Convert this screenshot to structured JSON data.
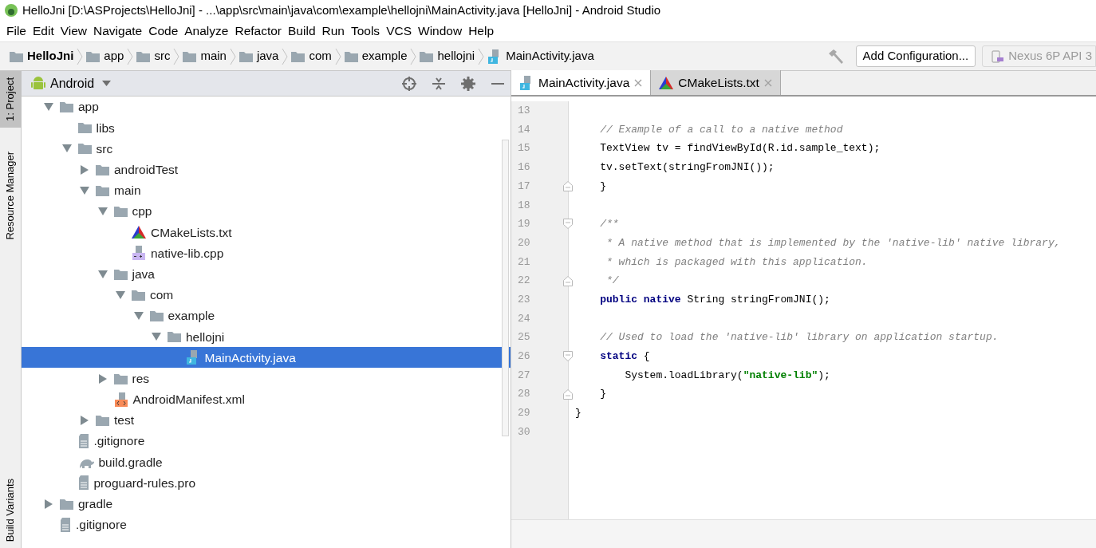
{
  "window": {
    "title": "HelloJni [D:\\ASProjects\\HelloJni] - ...\\app\\src\\main\\java\\com\\example\\hellojni\\MainActivity.java [HelloJni] - Android Studio"
  },
  "menu": [
    "File",
    "Edit",
    "View",
    "Navigate",
    "Code",
    "Analyze",
    "Refactor",
    "Build",
    "Run",
    "Tools",
    "VCS",
    "Window",
    "Help"
  ],
  "breadcrumb": [
    {
      "label": "HelloJni",
      "kind": "project"
    },
    {
      "label": "app",
      "kind": "folder"
    },
    {
      "label": "src",
      "kind": "folder"
    },
    {
      "label": "main",
      "kind": "folder"
    },
    {
      "label": "java",
      "kind": "folder"
    },
    {
      "label": "com",
      "kind": "folder"
    },
    {
      "label": "example",
      "kind": "folder"
    },
    {
      "label": "hellojni",
      "kind": "folder"
    },
    {
      "label": "MainActivity.java",
      "kind": "java"
    }
  ],
  "toolbar": {
    "config_button": "Add Configuration...",
    "device": "Nexus 6P API 3"
  },
  "side_tabs": [
    {
      "label": "1: Project",
      "selected": true
    },
    {
      "label": "Resource Manager",
      "selected": false
    },
    {
      "label": "Build Variants",
      "selected": false
    }
  ],
  "project_panel": {
    "view": "Android",
    "tree": [
      {
        "label": "app",
        "kind": "folder",
        "expanded": true,
        "selected": false,
        "children": [
          {
            "label": "libs",
            "kind": "folder",
            "selected": false
          },
          {
            "label": "src",
            "kind": "folder",
            "expanded": true,
            "selected": false,
            "children": [
              {
                "label": "androidTest",
                "kind": "folder",
                "expanded": false,
                "selected": false
              },
              {
                "label": "main",
                "kind": "folder",
                "expanded": true,
                "selected": false,
                "children": [
                  {
                    "label": "cpp",
                    "kind": "folder",
                    "expanded": true,
                    "selected": false,
                    "children": [
                      {
                        "label": "CMakeLists.txt",
                        "kind": "cmake",
                        "selected": false
                      },
                      {
                        "label": "native-lib.cpp",
                        "kind": "cpp",
                        "selected": false
                      }
                    ]
                  },
                  {
                    "label": "java",
                    "kind": "folder",
                    "expanded": true,
                    "selected": false,
                    "children": [
                      {
                        "label": "com",
                        "kind": "folder",
                        "expanded": true,
                        "selected": false,
                        "children": [
                          {
                            "label": "example",
                            "kind": "folder",
                            "expanded": true,
                            "selected": false,
                            "children": [
                              {
                                "label": "hellojni",
                                "kind": "folder",
                                "expanded": true,
                                "selected": false,
                                "children": [
                                  {
                                    "label": "MainActivity.java",
                                    "kind": "java",
                                    "selected": true
                                  }
                                ]
                              }
                            ]
                          }
                        ]
                      }
                    ]
                  },
                  {
                    "label": "res",
                    "kind": "folder",
                    "expanded": false,
                    "selected": false
                  },
                  {
                    "label": "AndroidManifest.xml",
                    "kind": "xml",
                    "selected": false
                  }
                ]
              },
              {
                "label": "test",
                "kind": "folder",
                "expanded": false,
                "selected": false
              }
            ]
          },
          {
            "label": ".gitignore",
            "kind": "text",
            "selected": false
          },
          {
            "label": "build.gradle",
            "kind": "gradle",
            "selected": false
          },
          {
            "label": "proguard-rules.pro",
            "kind": "text",
            "selected": false
          }
        ]
      },
      {
        "label": "gradle",
        "kind": "folder",
        "expanded": false,
        "selected": false
      },
      {
        "label": ".gitignore",
        "kind": "text",
        "selected": false
      }
    ]
  },
  "editor_tabs": [
    {
      "label": "MainActivity.java",
      "kind": "java",
      "selected": true
    },
    {
      "label": "CMakeLists.txt",
      "kind": "cmake",
      "selected": false
    }
  ],
  "code": [
    {
      "number": "13"
    },
    {
      "number": "14",
      "tokens": [
        {
          "kind": "comment",
          "text": "    // Example of a call to a native method"
        }
      ]
    },
    {
      "number": "15",
      "tokens": [
        {
          "kind": "plain",
          "text": "    TextView tv = findViewById(R.id.sample_text);"
        }
      ]
    },
    {
      "number": "16",
      "tokens": [
        {
          "kind": "plain",
          "text": "    tv.setText(stringFromJNI());"
        }
      ]
    },
    {
      "number": "17",
      "kind": "foldend",
      "tokens": [
        {
          "kind": "plain",
          "text": "    }"
        }
      ]
    },
    {
      "number": "18"
    },
    {
      "number": "19",
      "kind": "foldstart",
      "tokens": [
        {
          "kind": "comment",
          "text": "    /**"
        }
      ]
    },
    {
      "number": "20",
      "tokens": [
        {
          "kind": "comment",
          "text": "     * A native method that is implemented by the 'native-lib' native library,"
        }
      ]
    },
    {
      "number": "21",
      "tokens": [
        {
          "kind": "comment",
          "text": "     * which is packaged with this application."
        }
      ]
    },
    {
      "number": "22",
      "kind": "foldend",
      "tokens": [
        {
          "kind": "comment",
          "text": "     */"
        }
      ]
    },
    {
      "number": "23",
      "tokens": [
        {
          "kind": "keyword",
          "text": "    public native"
        },
        {
          "kind": "plain",
          "text": " String stringFromJNI();"
        }
      ]
    },
    {
      "number": "24"
    },
    {
      "number": "25",
      "tokens": [
        {
          "kind": "comment",
          "text": "    // Used to load the 'native-lib' library on application startup."
        }
      ]
    },
    {
      "number": "26",
      "kind": "foldstart",
      "tokens": [
        {
          "kind": "keyword",
          "text": "    static"
        },
        {
          "kind": "plain",
          "text": " {"
        }
      ]
    },
    {
      "number": "27",
      "tokens": [
        {
          "kind": "plain",
          "text": "        System.loadLibrary("
        },
        {
          "kind": "string",
          "text": "\"native-lib\""
        },
        {
          "kind": "plain",
          "text": ");"
        }
      ]
    },
    {
      "number": "28",
      "kind": "foldend",
      "tokens": [
        {
          "kind": "plain",
          "text": "    }"
        }
      ]
    },
    {
      "number": "29",
      "tokens": [
        {
          "kind": "plain",
          "text": "}"
        }
      ]
    },
    {
      "number": "30"
    }
  ]
}
